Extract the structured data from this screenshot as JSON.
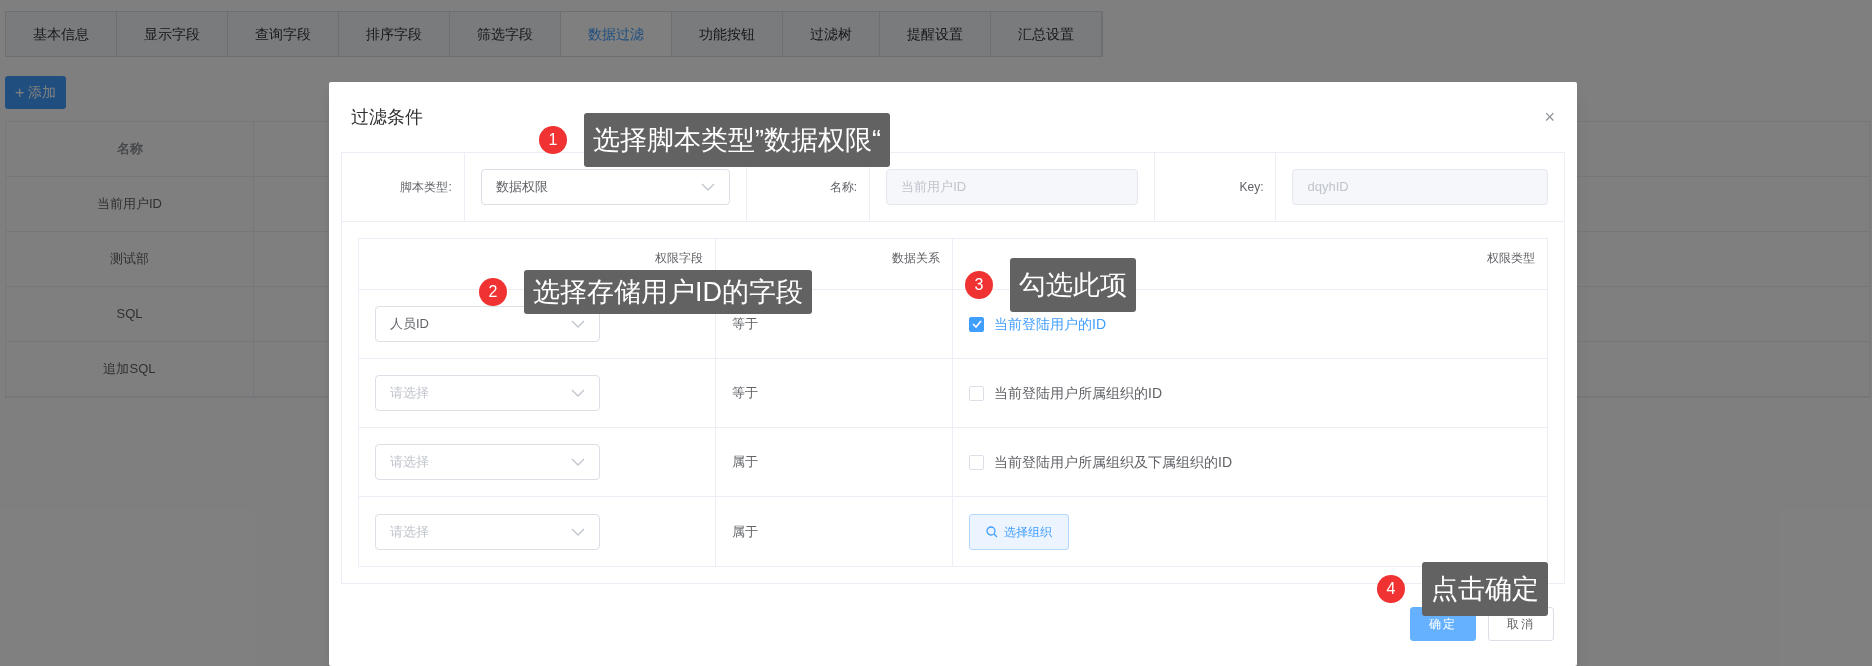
{
  "tabs": [
    {
      "label": "基本信息",
      "selected": false
    },
    {
      "label": "显示字段",
      "selected": false
    },
    {
      "label": "查询字段",
      "selected": false
    },
    {
      "label": "排序字段",
      "selected": false
    },
    {
      "label": "筛选字段",
      "selected": false
    },
    {
      "label": "数据过滤",
      "selected": true
    },
    {
      "label": "功能按钮",
      "selected": false
    },
    {
      "label": "过滤树",
      "selected": false
    },
    {
      "label": "提醒设置",
      "selected": false
    },
    {
      "label": "汇总设置",
      "selected": false
    }
  ],
  "add_button": {
    "icon": "+",
    "label": "添加"
  },
  "list_table": {
    "header": "名称",
    "rows": [
      "当前用户ID",
      "测试部",
      "SQL",
      "追加SQL"
    ]
  },
  "dialog": {
    "title": "过滤条件",
    "close": "×",
    "form": [
      {
        "label": "脚本类型:",
        "value": "数据权限",
        "kind": "select",
        "disabled": false
      },
      {
        "label": "名称:",
        "value": "当前用户ID",
        "kind": "input",
        "disabled": true
      },
      {
        "label": "Key:",
        "value": "dqyhID",
        "kind": "input",
        "disabled": true
      }
    ],
    "permission_table": {
      "columns": [
        "权限字段",
        "数据关系",
        "权限类型"
      ],
      "rows": [
        {
          "field": {
            "value": "人员ID"
          },
          "relation": "等于",
          "option": {
            "kind": "checkbox",
            "label": "当前登陆用户的ID",
            "checked": true
          }
        },
        {
          "field": {
            "placeholder": "请选择"
          },
          "relation": "等于",
          "option": {
            "kind": "checkbox",
            "label": "当前登陆用户所属组织的ID",
            "checked": false
          }
        },
        {
          "field": {
            "placeholder": "请选择"
          },
          "relation": "属于",
          "option": {
            "kind": "checkbox",
            "label": "当前登陆用户所属组织及下属组织的ID",
            "checked": false
          }
        },
        {
          "field": {
            "placeholder": "请选择"
          },
          "relation": "属于",
          "option": {
            "kind": "button",
            "label": "选择组织"
          }
        }
      ]
    },
    "buttons": [
      {
        "label": "确定",
        "primary": true
      },
      {
        "label": "取消",
        "primary": false
      }
    ]
  },
  "callouts": [
    {
      "number": "1",
      "text": "选择脚本类型”数据权限“"
    },
    {
      "number": "2",
      "text": "选择存储用户ID的字段"
    },
    {
      "number": "3",
      "text": "勾选此项"
    },
    {
      "number": "4",
      "text": "点击确定"
    }
  ]
}
